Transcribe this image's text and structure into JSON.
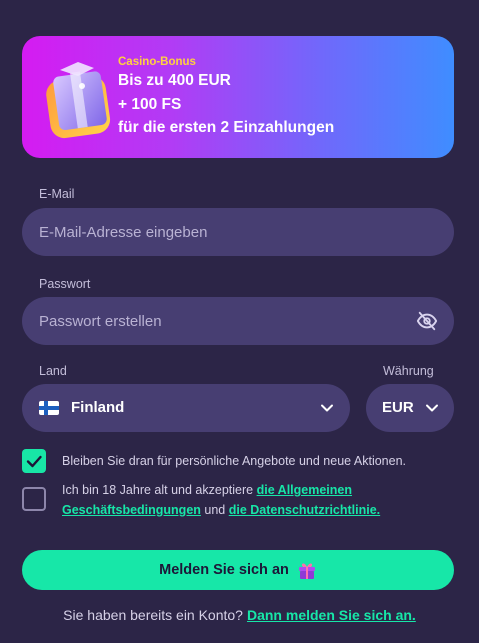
{
  "banner": {
    "tag": "Casino-Bonus",
    "line1": "Bis zu 400 EUR",
    "line2": "+ 100 FS",
    "line3": "für die ersten 2 Einzahlungen"
  },
  "email": {
    "label": "E-Mail",
    "placeholder": "E-Mail-Adresse eingeben",
    "value": ""
  },
  "password": {
    "label": "Passwort",
    "placeholder": "Passwort erstellen",
    "value": ""
  },
  "country": {
    "label": "Land",
    "value": "Finland"
  },
  "currency": {
    "label": "Währung",
    "value": "EUR"
  },
  "consent_offers": {
    "checked": true,
    "text": "Bleiben Sie dran für persönliche Angebote und neue Aktionen."
  },
  "consent_terms": {
    "checked": false,
    "text_before": "Ich bin 18 Jahre alt und akzeptiere",
    "terms_link": "die Allgemeinen Geschäftsbedingungen",
    "text_middle": "und",
    "privacy_link": "die Datenschutzrichtlinie."
  },
  "submit": {
    "label": "Melden Sie sich an"
  },
  "footer": {
    "text": "Sie haben bereits ein Konto?",
    "login_link": "Dann melden Sie sich an."
  },
  "colors": {
    "background": "#2c2547",
    "field": "#473e72",
    "accent": "#17e7a8",
    "banner_tag": "#ffd23f"
  }
}
